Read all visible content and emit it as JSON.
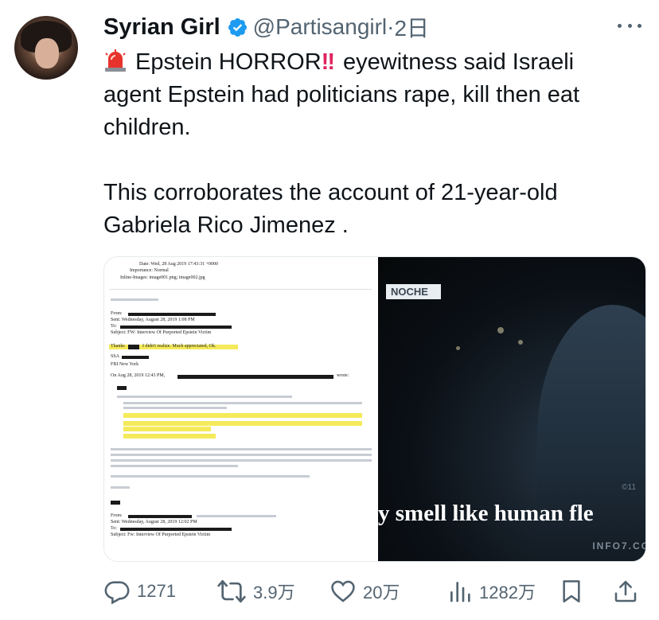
{
  "author": {
    "name": "Syrian Girl",
    "handle": "@Partisangirl",
    "separator": "·",
    "time": "2日"
  },
  "tweet": {
    "line1_prefix": "Epstein HORROR",
    "line1_bang": "!!",
    "line1_rest": "eyewitness said Israeli",
    "line2": "agent Epstein had politicians rape, kill then eat",
    "line3": "children.",
    "line4": "This corroborates the account of  21-year-old",
    "line5": "Gabriela Rico Jimenez ."
  },
  "media": {
    "doc": {
      "date_line": "Date: Wed, 28 Aug 2019 17:43:31 +0000",
      "importance": "Importance: Normal",
      "inline_images": "Inline-Images: image001.png; image002.jpg",
      "from": "From:",
      "sent": "Sent: Wednesday, August 28, 2019 1:08 PM",
      "to": "To:",
      "subject": "Subject: FW: Interview Of Purported Epstein Victim",
      "thanks": "Thanks",
      "thanks_rest": "I didn't realize. Much appreciated, Ok.",
      "ssa": "SSA",
      "office": "FBI New York",
      "on_line": "On Aug 28, 2019 12:43 PM,",
      "wrote": "wrote:",
      "sent2": "Sent: Wednesday, August 28, 2019 12:02 PM",
      "subject2": "Subject: Fw: Interview Of Purported Epstein Victim"
    },
    "video": {
      "sign": "NOCHE",
      "caption": "y smell like human fle",
      "watermark": "INFO7.CO",
      "channel": "©11"
    }
  },
  "actions": {
    "replies": "1271",
    "retweets": "3.9万",
    "likes": "20万",
    "views": "1282万"
  },
  "colors": {
    "text": "#0f1419",
    "secondary": "#536471",
    "verified": "#1d9bf0",
    "highlight": "#f4ea5a"
  }
}
